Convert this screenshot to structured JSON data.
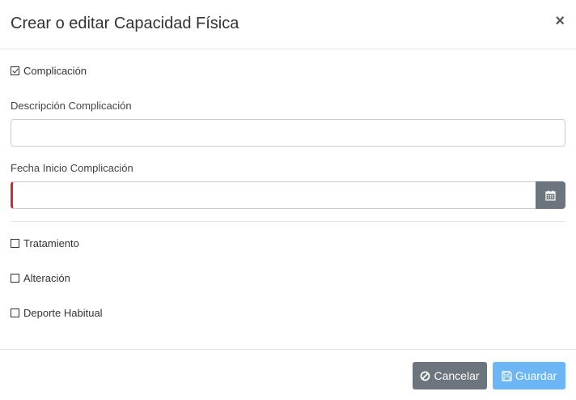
{
  "modal": {
    "title": "Crear o editar Capacidad Física",
    "close_symbol": "×"
  },
  "form": {
    "complicacion": {
      "label": "Complicación",
      "checked": true
    },
    "descripcion": {
      "label": "Descripción Complicación",
      "value": ""
    },
    "fecha_inicio": {
      "label": "Fecha Inicio Complicación",
      "value": "",
      "icon": "calendar-icon"
    },
    "tratamiento": {
      "label": "Tratamiento",
      "checked": false
    },
    "alteracion": {
      "label": "Alteración",
      "checked": false
    },
    "deporte": {
      "label": "Deporte Habitual",
      "checked": false
    }
  },
  "footer": {
    "cancel_label": "Cancelar",
    "cancel_icon": "ban-icon",
    "save_label": "Guardar",
    "save_icon": "floppy-disk-icon"
  },
  "colors": {
    "cancel_bg": "#6c757d",
    "save_bg": "#6cb6f5",
    "required_marker": "#c9302c"
  }
}
